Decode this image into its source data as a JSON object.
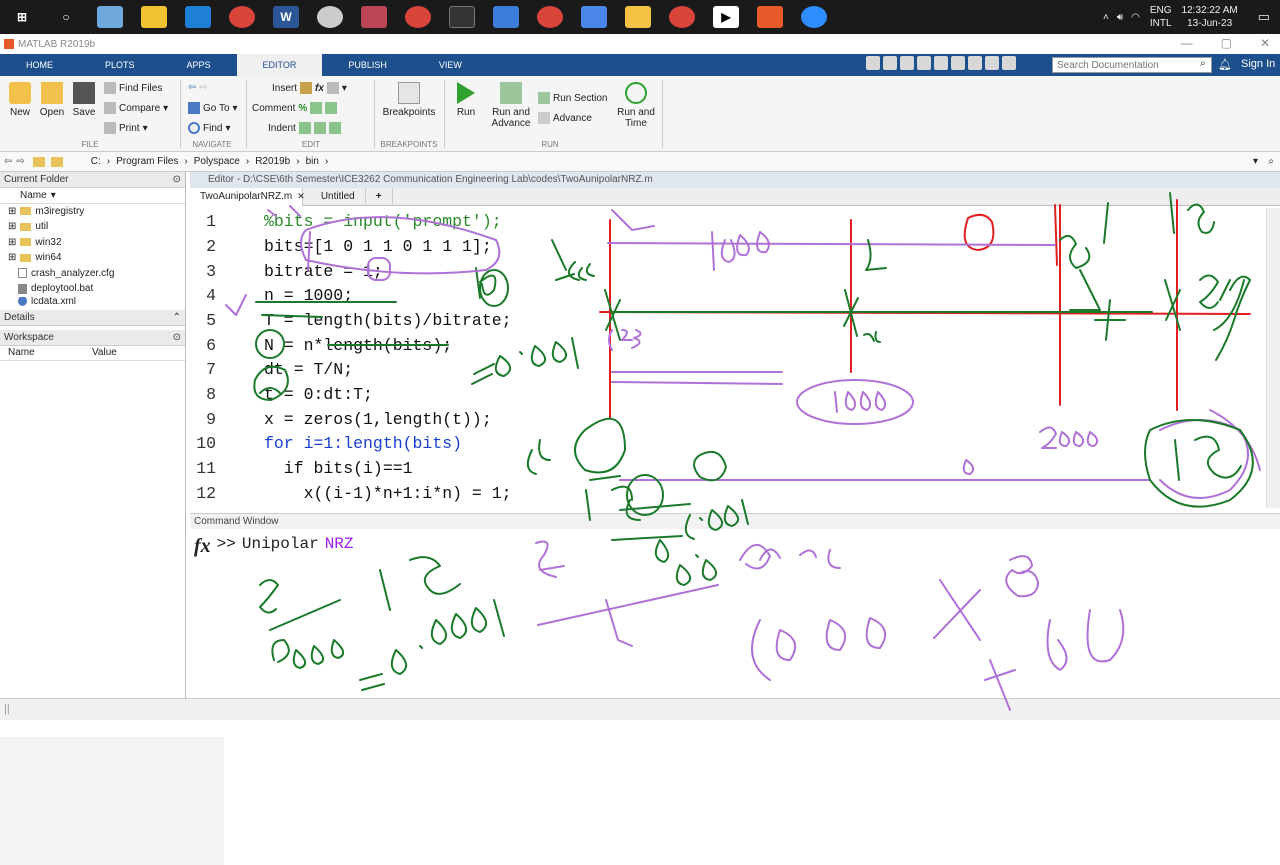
{
  "taskbar": {
    "icons": [
      "windows-start-icon",
      "search-icon",
      "app-icon",
      "sticky-notes-icon",
      "vscode-icon",
      "chrome-icon",
      "word-icon",
      "app-icon",
      "app-icon",
      "chrome-icon",
      "terminal-icon",
      "calculator-icon",
      "chrome-icon",
      "app-icon",
      "file-explorer-icon",
      "chrome-icon",
      "app-icon",
      "matlab-icon",
      "zoom-icon"
    ],
    "tray": {
      "lang1": "ENG",
      "lang2": "INTL",
      "time": "12:32:22 AM",
      "date": "13-Jun-23"
    }
  },
  "window": {
    "title": "MATLAB R2019b"
  },
  "ribbon": {
    "tabs": [
      "HOME",
      "PLOTS",
      "APPS",
      "EDITOR",
      "PUBLISH",
      "VIEW"
    ],
    "active_tab": "EDITOR",
    "search_placeholder": "Search Documentation",
    "signin": "Sign In",
    "file": {
      "new": "New",
      "open": "Open",
      "save": "Save",
      "find_files": "Find Files",
      "compare": "Compare",
      "print": "Print",
      "group": "FILE"
    },
    "navigate": {
      "go_to": "Go To",
      "find": "Find",
      "group": "NAVIGATE"
    },
    "edit": {
      "insert": "Insert",
      "comment": "Comment",
      "indent": "Indent",
      "group": "EDIT"
    },
    "breakpoints": {
      "label": "Breakpoints",
      "group": "BREAKPOINTS"
    },
    "run": {
      "run": "Run",
      "run_and_advance": "Run and Advance",
      "run_section": "Run Section",
      "advance": "Advance",
      "run_and_time": "Run and Time",
      "group": "RUN"
    }
  },
  "address": {
    "drive": "C:",
    "path": [
      "Program Files",
      "Polyspace",
      "R2019b",
      "bin"
    ]
  },
  "current_folder": {
    "title": "Current Folder",
    "column": "Name",
    "items": [
      {
        "name": "m3iregistry",
        "type": "folder"
      },
      {
        "name": "util",
        "type": "folder"
      },
      {
        "name": "win32",
        "type": "folder"
      },
      {
        "name": "win64",
        "type": "folder"
      },
      {
        "name": "crash_analyzer.cfg",
        "type": "file"
      },
      {
        "name": "deploytool.bat",
        "type": "file"
      },
      {
        "name": "lcdata.xml",
        "type": "file"
      }
    ]
  },
  "details": {
    "title": "Details"
  },
  "workspace": {
    "title": "Workspace",
    "columns": [
      "Name",
      "Value"
    ]
  },
  "editor": {
    "title": "Editor - D:\\CSE\\6th Semester\\ICE3262 Communication Engineering Lab\\codes\\TwoAunipolarNRZ.m",
    "tabs": [
      "TwoAunipolarNRZ.m",
      "Untitled",
      "+"
    ],
    "lines": [
      {
        "n": "1",
        "code": "%bits = input('prompt');"
      },
      {
        "n": "2",
        "code": "bits=[1 0 1 1 0 1 1 1];"
      },
      {
        "n": "3",
        "code": "bitrate = 1;"
      },
      {
        "n": "4",
        "code": "n = 1000;"
      },
      {
        "n": "5",
        "code": "T = length(bits)/bitrate;"
      },
      {
        "n": "6",
        "code": "N = n*length(bits);"
      },
      {
        "n": "7",
        "code": "dt = T/N;"
      },
      {
        "n": "8",
        "code": "t = 0:dt:T;"
      },
      {
        "n": "9",
        "code": "x = zeros(1,length(t));"
      },
      {
        "n": "10",
        "code": "for i=1:length(bits)"
      },
      {
        "n": "11",
        "code": "  if bits(i)==1"
      },
      {
        "n": "12",
        "code": "    x((i-1)*n+1:i*n) = 1;"
      }
    ]
  },
  "command_window": {
    "title": "Command Window",
    "prompt": ">>",
    "input": "Unipolar",
    "arg": "NRZ"
  },
  "annotations": {
    "green": [
      "1/1000",
      "8",
      "=0.001",
      "t=0",
      "t=0.001",
      "t=0.008 sec",
      "8",
      "1 5",
      "8/8000 = 0.001",
      "1000",
      "8",
      "1001",
      "2000",
      "0"
    ],
    "purple": [
      "8",
      "1000",
      "2000",
      "8",
      "1",
      "1000 X 8",
      "8000",
      "= 0.001",
      "1/8 = 0.008 sec",
      "123"
    ],
    "red": [
      "0",
      "1"
    ]
  }
}
